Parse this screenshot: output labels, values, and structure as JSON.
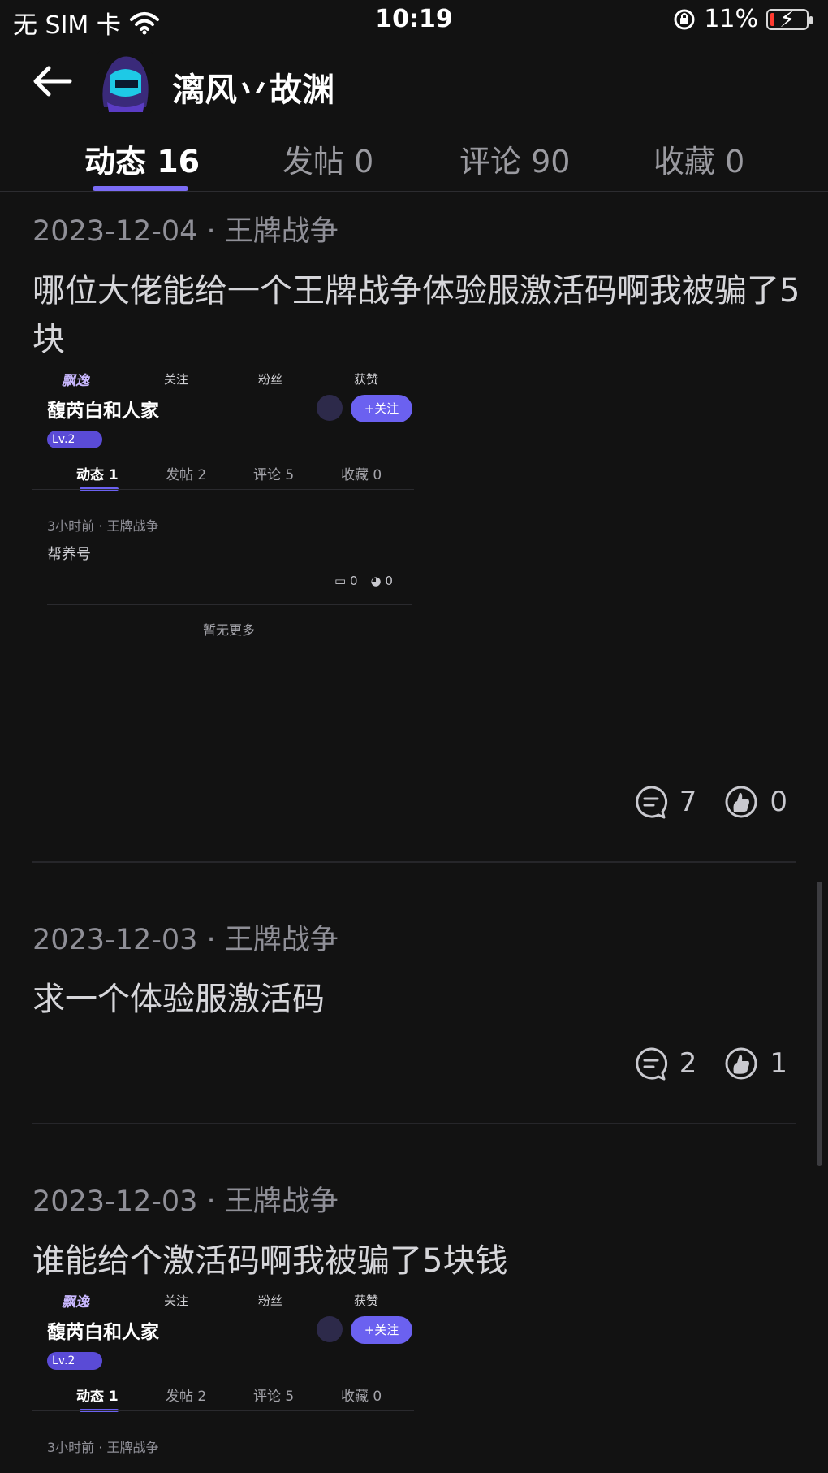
{
  "status_bar": {
    "carrier": "无 SIM 卡",
    "time": "10:19",
    "battery": "11%"
  },
  "header": {
    "username": "漓风丷故渊"
  },
  "tabs": [
    {
      "label": "动态 16"
    },
    {
      "label": "发帖 0"
    },
    {
      "label": "评论 90"
    },
    {
      "label": "收藏 0"
    }
  ],
  "posts": [
    {
      "meta": "2023-12-04 · 王牌战争",
      "content": "哪位大佬能给一个王牌战争体验服激活码啊我被骗了5块",
      "comments": "7",
      "likes": "0"
    },
    {
      "meta": "2023-12-03 · 王牌战争",
      "content": "求一个体验服激活码",
      "comments": "2",
      "likes": "1"
    },
    {
      "meta": "2023-12-03 · 王牌战争",
      "content": "谁能给个激活码啊我被骗了5块钱"
    }
  ],
  "embed": {
    "logo_text": "飘逸",
    "follow_label": "关注",
    "fans_label": "粉丝",
    "likes_label": "获赞",
    "name": "馥芮白和人家",
    "follow_button": "+关注",
    "level": "Lv.2",
    "tabs": [
      "动态 1",
      "发帖 2",
      "评论 5",
      "收藏 0"
    ],
    "post_meta": "3小时前 · 王牌战争",
    "post_text": "帮养号",
    "post_comments": "0",
    "post_likes": "0",
    "no_more": "暂无更多"
  }
}
